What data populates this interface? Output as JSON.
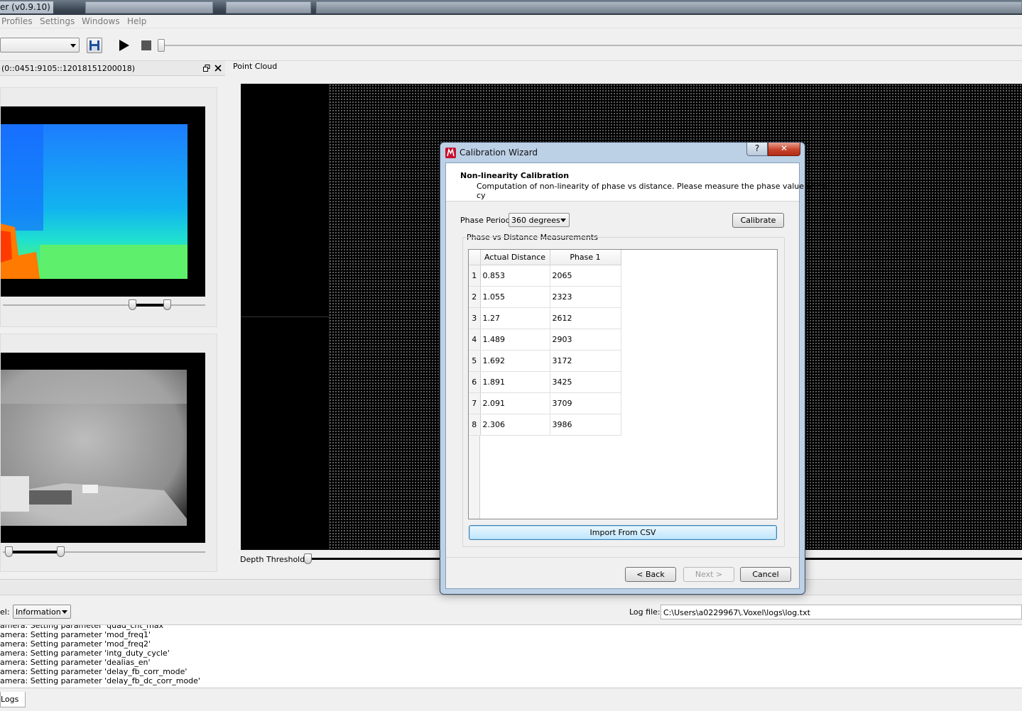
{
  "window": {
    "title": "er (v0.9.10)"
  },
  "menubar": {
    "items": [
      "Profiles",
      "Settings",
      "Windows",
      "Help"
    ]
  },
  "left_panel": {
    "title": "(0::0451:9105::12018151200018)"
  },
  "point_cloud": {
    "title": "Point Cloud",
    "depth_threshold_label": "Depth Threshold:"
  },
  "dialog": {
    "title": "Calibration Wizard",
    "help_label": "?",
    "close_label": "✕",
    "heading": "Non-linearity Calibration",
    "description": "Computation of non-linearity of phase vs distance. Please measure the phase value at cx,",
    "description_cont": "cy",
    "phase_period_label": "Phase Period",
    "phase_period_value": "360 degrees",
    "calibrate_label": "Calibrate",
    "group_title": "Phase vs Distance Measurements",
    "table": {
      "columns": [
        "Actual Distance",
        "Phase 1"
      ],
      "rows": [
        {
          "n": "1",
          "distance": "0.853",
          "phase": "2065"
        },
        {
          "n": "2",
          "distance": "1.055",
          "phase": "2323"
        },
        {
          "n": "3",
          "distance": "1.27",
          "phase": "2612"
        },
        {
          "n": "4",
          "distance": "1.489",
          "phase": "2903"
        },
        {
          "n": "5",
          "distance": "1.692",
          "phase": "3172"
        },
        {
          "n": "6",
          "distance": "1.891",
          "phase": "3425"
        },
        {
          "n": "7",
          "distance": "2.091",
          "phase": "3709"
        },
        {
          "n": "8",
          "distance": "2.306",
          "phase": "3986"
        }
      ]
    },
    "import_label": "Import From CSV",
    "back_label": "< Back",
    "next_label": "Next >",
    "cancel_label": "Cancel"
  },
  "log": {
    "level_label": "el:",
    "level_value": "Information",
    "file_label": "Log file:",
    "file_value": "C:\\Users\\a0229967\\.Voxel\\logs\\log.txt",
    "lines": [
      "amera: Setting parameter 'quad_cnt_max'",
      "amera: Setting parameter 'mod_freq1'",
      "amera: Setting parameter 'mod_freq2'",
      "amera: Setting parameter 'intg_duty_cycle'",
      "amera: Setting parameter 'dealias_en'",
      "amera: Setting parameter 'delay_fb_corr_mode'",
      "amera: Setting parameter 'delay_fb_dc_corr_mode'"
    ],
    "tab_label": "Logs"
  }
}
